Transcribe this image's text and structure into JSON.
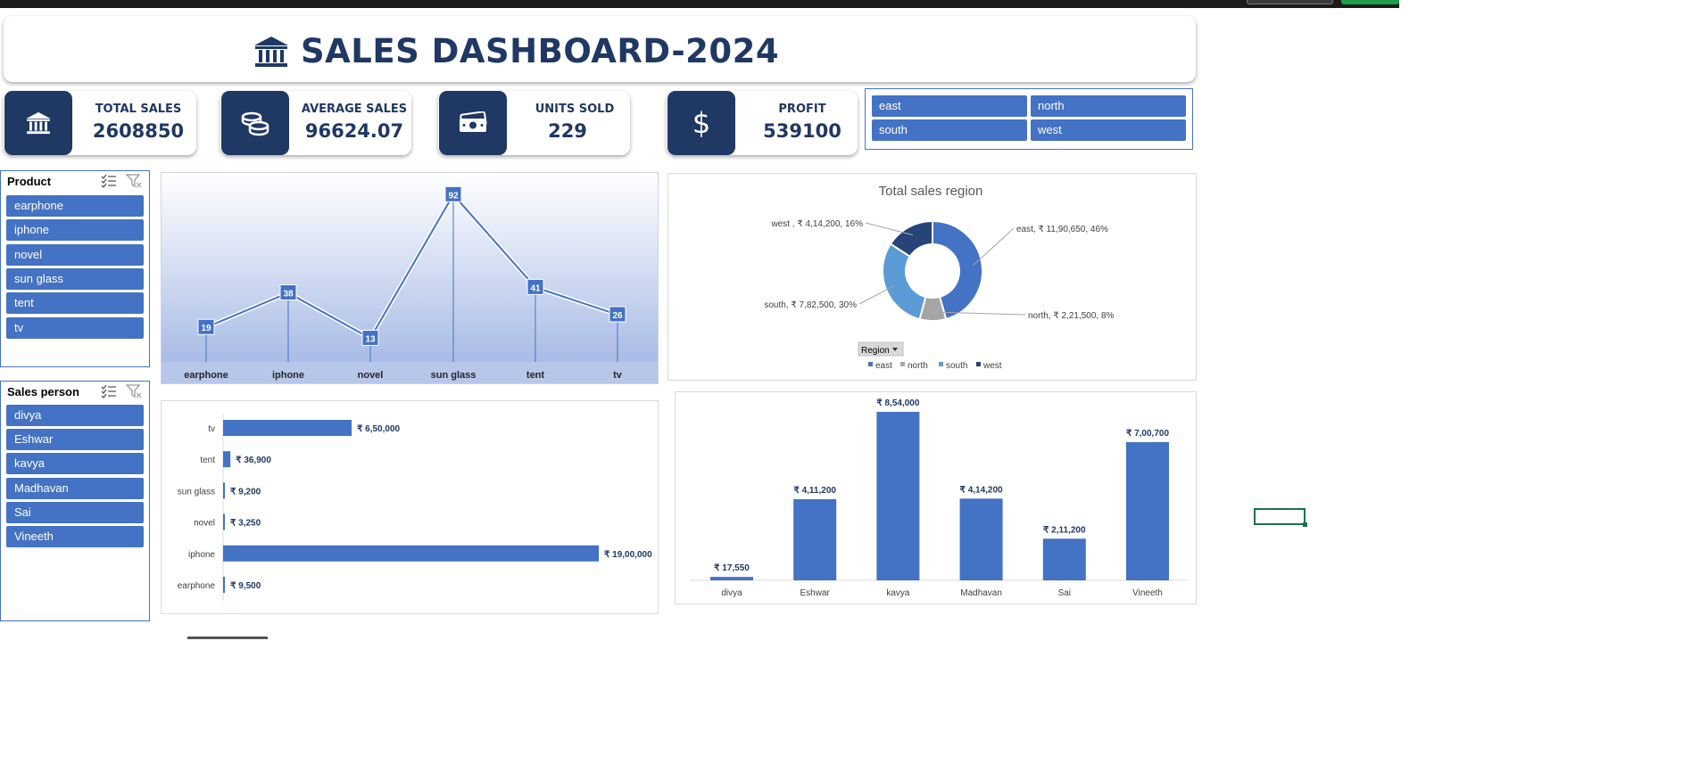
{
  "dashboard": {
    "title": "SALES DASHBOARD-2024"
  },
  "kpis": [
    {
      "label": "TOTAL SALES",
      "value": "2608850",
      "icon": "bank-icon"
    },
    {
      "label": "AVERAGE SALES",
      "value": "96624.07",
      "icon": "coins-icon"
    },
    {
      "label": "UNITS SOLD",
      "value": "229",
      "icon": "cash-icon"
    },
    {
      "label": "PROFIT",
      "value": "539100",
      "icon": "dollar-icon"
    }
  ],
  "region_slicer": {
    "items": [
      "east",
      "north",
      "south",
      "west"
    ]
  },
  "product_slicer": {
    "header": "Product",
    "items": [
      "earphone",
      "iphone",
      "novel",
      "sun glass",
      "tent",
      "tv"
    ]
  },
  "salesperson_slicer": {
    "header": "Sales person",
    "items": [
      "divya",
      "Eshwar",
      "kavya",
      "Madhavan",
      "Sai",
      "Vineeth"
    ]
  },
  "pie": {
    "title": "Total sales region",
    "filter_button": "Region"
  },
  "colors": {
    "navy": "#1f3864",
    "accent": "#4472c4",
    "grey": "#a5a5a5",
    "light_blue": "#5b9bd5",
    "dark_blue": "#264478",
    "selection_green": "#1e7145"
  },
  "chart_data": [
    {
      "type": "line",
      "categories": [
        "earphone",
        "iphone",
        "novel",
        "sun glass",
        "tent",
        "tv"
      ],
      "values": [
        19,
        38,
        13,
        92,
        41,
        26
      ],
      "ylim": [
        0,
        100
      ]
    },
    {
      "type": "pie",
      "title": "Total sales region",
      "categories": [
        "east",
        "north",
        "south",
        "west"
      ],
      "values": [
        1190650,
        221500,
        782500,
        414200
      ],
      "labels": [
        "east, ₹ 11,90,650, 46%",
        "north, ₹ 2,21,500, 8%",
        "south, ₹ 7,82,500, 30%",
        "west , ₹ 4,14,200, 16%"
      ],
      "legend": "bottom"
    },
    {
      "type": "bar",
      "orientation": "horizontal",
      "categories": [
        "earphone",
        "iphone",
        "novel",
        "sun glass",
        "tent",
        "tv"
      ],
      "values": [
        9500,
        1900000,
        3250,
        9200,
        36900,
        650000
      ],
      "labels": [
        "₹ 9,500",
        "₹ 19,00,000",
        "₹ 3,250",
        "₹ 9,200",
        "₹ 36,900",
        "₹ 6,50,000"
      ]
    },
    {
      "type": "bar",
      "categories": [
        "divya",
        "Eshwar",
        "kavya",
        "Madhavan",
        "Sai",
        "Vineeth"
      ],
      "values": [
        17550,
        411200,
        854000,
        414200,
        211200,
        700700
      ],
      "labels": [
        "₹ 17,550",
        "₹ 4,11,200",
        "₹ 8,54,000",
        "₹ 4,14,200",
        "₹ 2,11,200",
        "₹ 7,00,700"
      ]
    }
  ]
}
